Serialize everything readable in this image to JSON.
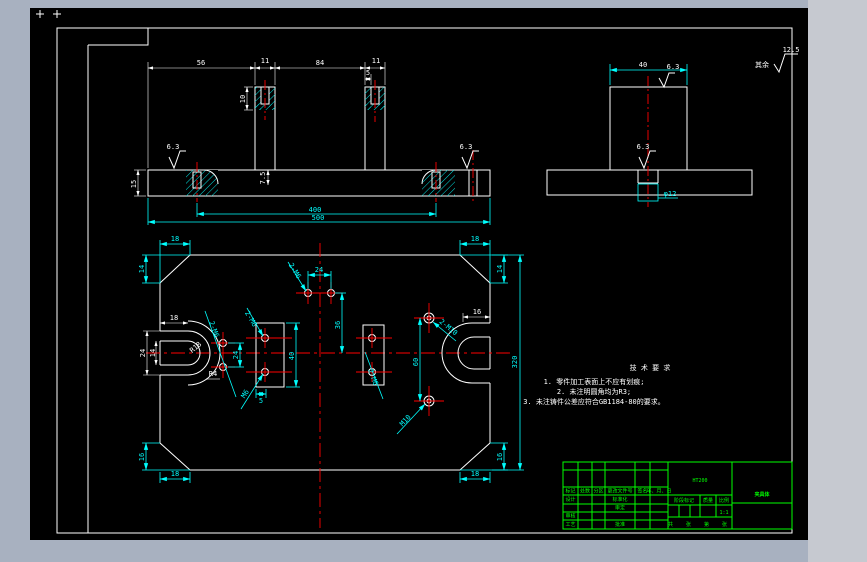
{
  "colors": {
    "page_bg": "#a8b1c0",
    "side_panel_bg": "#c6c9d0",
    "canvas_bg": "#000000",
    "line": "#ffffff",
    "dimension": "#00ffff",
    "centerline": "#ff0000",
    "title_table": "#00ff00"
  },
  "general_note": {
    "label": "其余",
    "roughness_value": "12.5"
  },
  "front_view": {
    "dim_left_offset": "56",
    "dim_boss_left": "11",
    "dim_boss_spacing": "84",
    "dim_boss_right": "11",
    "dim_thread_offset": "5",
    "dim_thread_depth": "10",
    "dim_step": "7.5",
    "dim_plate_height": "15",
    "dim_hole_span": "400",
    "dim_plate_length": "500",
    "roughness_left": "6.3",
    "roughness_right": "6.3"
  },
  "side_view": {
    "dim_width": "40",
    "roughness_top": "6.3",
    "roughness_hole": "6.3",
    "hole_label": "φ12"
  },
  "plan_view": {
    "dim_tl_chamfer_w": "18",
    "dim_tl_chamfer_h": "14",
    "dim_bl_chamfer_h": "16",
    "dim_bl_chamfer_w": "18",
    "dim_tr_chamfer_w": "18",
    "dim_tr_chamfer_h": "14",
    "dim_br_chamfer_h": "16",
    "dim_br_chamfer_w": "18",
    "dim_plate_width": "320",
    "left_slot": {
      "dim_depth": "18",
      "dim_outer": "24",
      "dim_inner": "14",
      "radius_outer": "R18",
      "radius_inner": "R4"
    },
    "right_slot": {
      "dim_width": "16"
    },
    "top_holes": {
      "dim_spacing": "24",
      "dim_offset": "36",
      "label": "2-M6"
    },
    "left_holes": {
      "dim_spacing": "24",
      "label": "2-M6"
    },
    "left_pad": {
      "dim_height": "40",
      "dim_offset": "5",
      "label_top": "2-M6",
      "label_bottom": "M6"
    },
    "right_pad": {
      "label": "2-M6"
    },
    "right_holes": {
      "dim_spacing": "60",
      "label_top": "2-M10",
      "label_bottom": "M10"
    }
  },
  "tech_requirements": {
    "title": "技 术 要 求",
    "items": [
      "1. 零件加工表面上不应有划痕;",
      "2. 未注明圆角均为R3;",
      "3. 未注铸件公差应符合GB1184-80的要求。"
    ]
  },
  "title_block": {
    "material": "HT200",
    "part_name": "夹具体",
    "scale_value": "1:1",
    "header_cells": [
      "标记",
      "处数",
      "分区",
      "更改文件号",
      "签名",
      "年、月、日"
    ],
    "row_labels": [
      "设计",
      "审核",
      "工艺"
    ],
    "mid_labels": [
      "标准化",
      "审定",
      "批准"
    ],
    "stage_label": "阶段标记",
    "weight_label": "质量",
    "scale_label": "比例",
    "sheet_note": "共 张 第 张"
  }
}
